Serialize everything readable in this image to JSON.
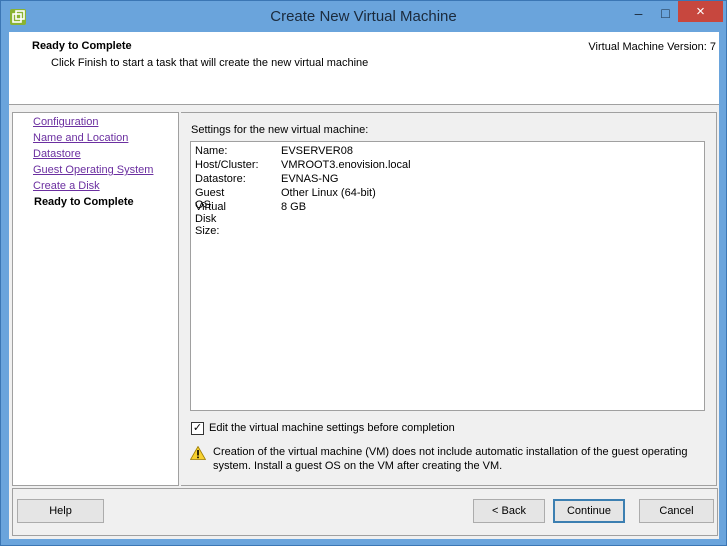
{
  "window": {
    "title": "Create New Virtual Machine",
    "close_icon": "×",
    "minimize_icon": "–",
    "maximize_icon": "□"
  },
  "header": {
    "title": "Ready to Complete",
    "subtitle": "Click Finish to start a task that will create the new virtual machine",
    "version": "Virtual Machine Version: 7"
  },
  "steps": [
    {
      "label": "Configuration"
    },
    {
      "label": "Name and Location"
    },
    {
      "label": "Datastore"
    },
    {
      "label": "Guest Operating System"
    },
    {
      "label": "Create a Disk"
    },
    {
      "label": "Ready to Complete",
      "active": true
    }
  ],
  "settings": {
    "label": "Settings for the new virtual machine:",
    "rows": [
      {
        "key": "Name:",
        "value": "EVSERVER08"
      },
      {
        "key": "Host/Cluster:",
        "value": "VMROOT3.enovision.local"
      },
      {
        "key": "Datastore:",
        "value": "EVNAS-NG"
      },
      {
        "key": "Guest OS:",
        "value": "Other Linux (64-bit)"
      },
      {
        "key": "Virtual Disk Size:",
        "value": "8 GB"
      }
    ]
  },
  "edit_checkbox": {
    "checked": true,
    "checkmark": "✓",
    "label": "Edit the virtual machine settings before completion"
  },
  "warning": {
    "icon": "warning-icon",
    "text": "Creation of the virtual machine (VM) does not include automatic installation of the guest operating system. Install a guest OS on the VM after creating the VM."
  },
  "buttons": {
    "help": "Help",
    "back": "< Back",
    "continue": "Continue",
    "cancel": "Cancel"
  }
}
